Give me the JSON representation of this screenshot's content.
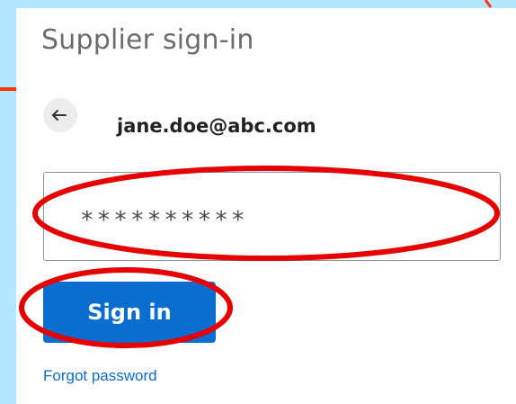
{
  "signin": {
    "title": "Supplier sign-in",
    "back_icon": "arrow-left-icon",
    "email": "jane.doe@abc.com",
    "password_masked": "**********",
    "signin_label": "Sign in",
    "forgot_label": "Forgot password"
  },
  "colors": {
    "background": "#b3e7ff",
    "primary_button": "#0a6ed1",
    "link": "#0a6ed1",
    "annotation": "#e60000",
    "accent_line": "#ff3300"
  }
}
